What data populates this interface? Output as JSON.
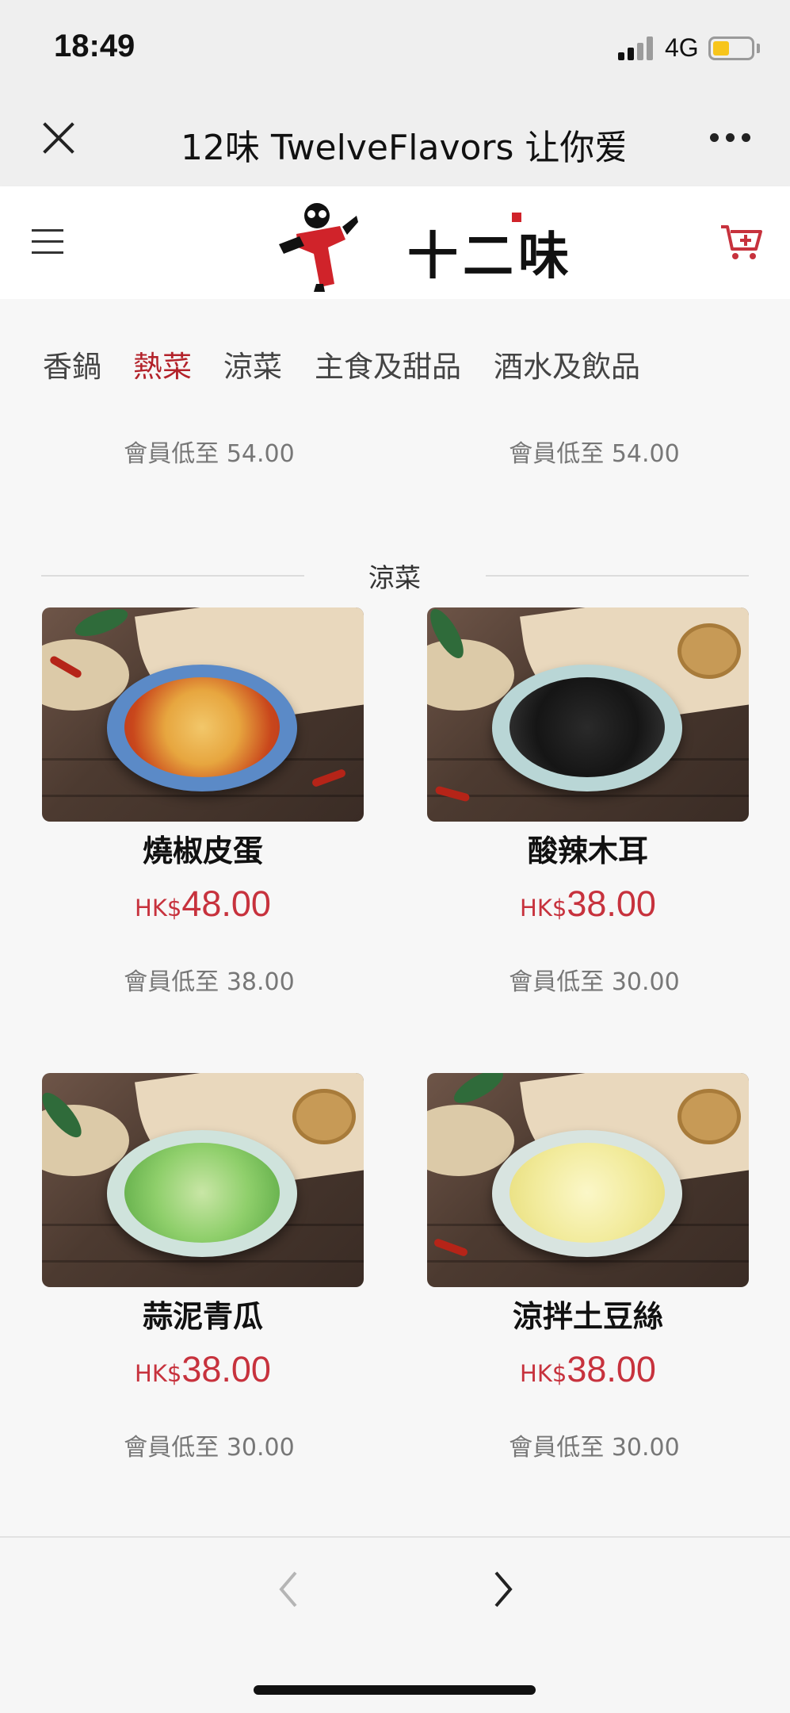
{
  "status_bar": {
    "time": "18:49",
    "network": "4G",
    "battery_color": "#f7c51c"
  },
  "browser": {
    "title": "12味 TwelveFlavors 让你爱",
    "close_icon": "close-icon",
    "more_icon": "more-icon"
  },
  "header": {
    "logo_text": "十二味",
    "menu_icon": "hamburger-icon",
    "cart_icon": "cart-icon",
    "accent_color": "#c7323d"
  },
  "tabs": [
    {
      "label": "香鍋",
      "active": false
    },
    {
      "label": "熱菜",
      "active": true
    },
    {
      "label": "涼菜",
      "active": false
    },
    {
      "label": "主食及甜品",
      "active": false
    },
    {
      "label": "酒水及飲品",
      "active": false
    }
  ],
  "previous_row": {
    "left_member_price": "會員低至 54.00",
    "right_member_price": "會員低至 54.00"
  },
  "section": {
    "title": "涼菜"
  },
  "products": [
    {
      "name": "燒椒皮蛋",
      "currency": "HK$",
      "price": "48.00",
      "member_price": "會員低至 38.00"
    },
    {
      "name": "酸辣木耳",
      "currency": "HK$",
      "price": "38.00",
      "member_price": "會員低至 30.00"
    },
    {
      "name": "蒜泥青瓜",
      "currency": "HK$",
      "price": "38.00",
      "member_price": "會員低至 30.00"
    },
    {
      "name": "涼拌土豆絲",
      "currency": "HK$",
      "price": "38.00",
      "member_price": "會員低至 30.00"
    }
  ],
  "bottom_nav": {
    "back_icon": "chevron-left-icon",
    "forward_icon": "chevron-right-icon"
  }
}
